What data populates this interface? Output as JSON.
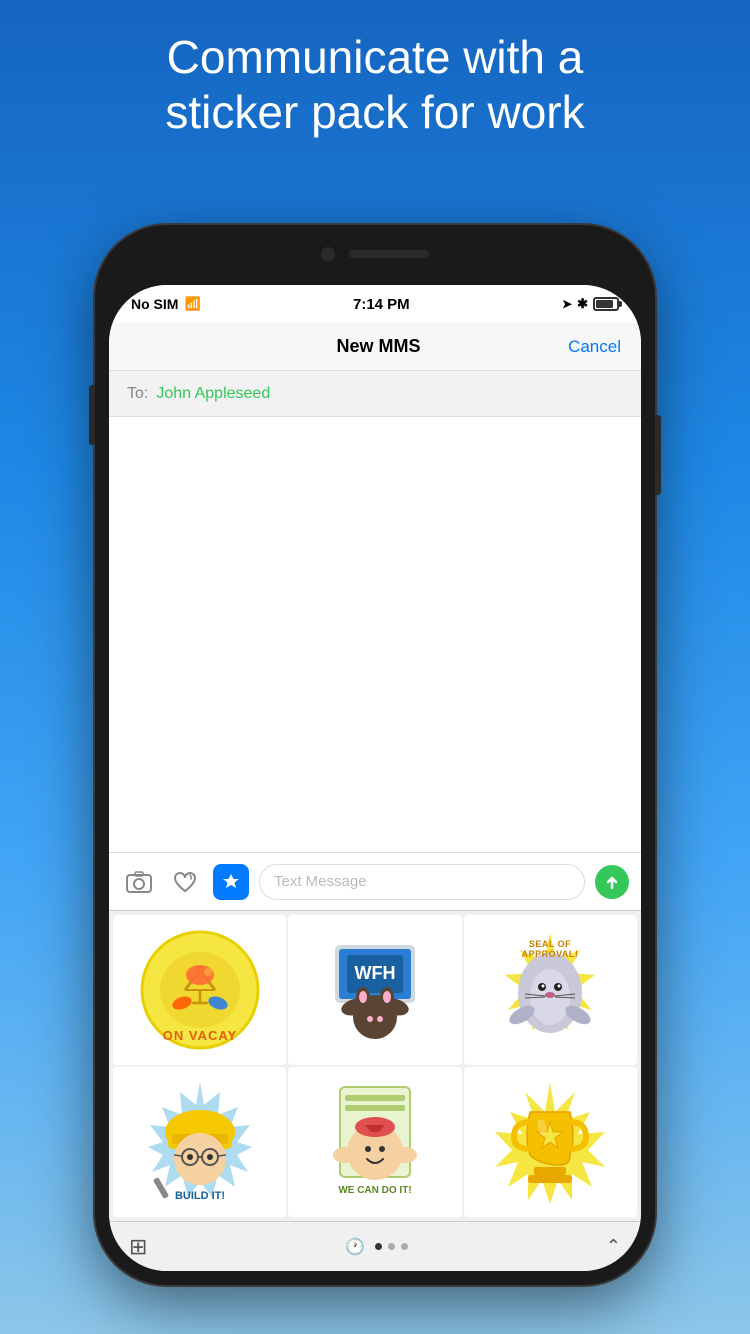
{
  "headline": {
    "line1": "Communicate with a",
    "line2": "sticker pack for work"
  },
  "status_bar": {
    "carrier": "No SIM",
    "time": "7:14 PM",
    "wifi": "wifi",
    "bt": "bt",
    "arrow": "▲",
    "battery": "battery"
  },
  "nav": {
    "title": "New MMS",
    "cancel": "Cancel"
  },
  "to_field": {
    "label": "To:",
    "contact": "John Appleseed"
  },
  "toolbar": {
    "text_placeholder": "Text Message"
  },
  "stickers": [
    {
      "label": "ON VACAY",
      "color": "#f5e642"
    },
    {
      "label": "WFH",
      "color": "#3a7bbf"
    },
    {
      "label": "SEAL OF APPROVAL",
      "color": "#f5e87a"
    },
    {
      "label": "BUILD IT!",
      "color": "#5bb8e8"
    },
    {
      "label": "WE CAN DO IT!",
      "color": "#a8d870"
    },
    {
      "label": "trophy",
      "color": "#f5e642"
    }
  ]
}
